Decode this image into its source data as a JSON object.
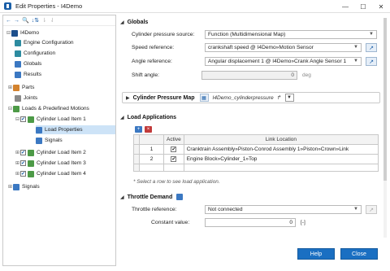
{
  "window": {
    "title": "Edit Properties - I4Demo",
    "min_label": "—",
    "max_label": "☐",
    "close_label": "✕"
  },
  "toolbar": {
    "back": "←",
    "forward": "→",
    "search": "🔍",
    "sort": "↓⇅",
    "dim1": "⇂",
    "dim2": "⇃"
  },
  "tree": {
    "items": [
      {
        "label": "I4Demo"
      },
      {
        "label": "Engine Configuration"
      },
      {
        "label": "Configuration"
      },
      {
        "label": "Globals"
      },
      {
        "label": "Results"
      },
      {
        "label": "Parts"
      },
      {
        "label": "Joints"
      },
      {
        "label": "Loads & Predefined Motions"
      },
      {
        "label": "Cylinder Load Item 1"
      },
      {
        "label": "Load Properties"
      },
      {
        "label": "Signals"
      },
      {
        "label": "Cylinder Load Item 2"
      },
      {
        "label": "Cylinder Load Item 3"
      },
      {
        "label": "Cylinder Load Item 4"
      },
      {
        "label": "Signals"
      }
    ]
  },
  "globals": {
    "title": "Globals",
    "pressure_source_label": "Cylinder pressure source:",
    "pressure_source_value": "Function (Multidimensional Map)",
    "speed_ref_label": "Speed reference:",
    "speed_ref_value": "crankshaft speed @ I4Demo»Motion Sensor",
    "angle_ref_label": "Angle reference:",
    "angle_ref_value": "Angular displacement 1 @ I4Demo»Crank Angle Sensor 1",
    "shift_label": "Shift angle:",
    "shift_value": "0",
    "shift_unit": "deg"
  },
  "pressure_map": {
    "title": "Cylinder Pressure Map",
    "value": "I4Demo_cylinderpressure"
  },
  "load_applications": {
    "title": "Load Applications",
    "columns": [
      "Active",
      "Link Location"
    ],
    "rows": [
      {
        "num": "1",
        "active": "✔",
        "location": "Cranktrain Assembly»Piston-Conrod Assembly 1»Piston»Crown»Link"
      },
      {
        "num": "2",
        "active": "✔",
        "location": "Engine Block»Cylinder_1»Top"
      }
    ],
    "note": "* Select a row to see load application."
  },
  "throttle": {
    "title": "Throttle Demand",
    "ref_label": "Throttle reference:",
    "ref_value": "Not connected",
    "const_label": "Constant value:",
    "const_value": "0",
    "const_unit": "[-]"
  },
  "buttons": {
    "help": "Help",
    "close": "Close"
  },
  "colors": {
    "accent": "#1a6fc2"
  }
}
